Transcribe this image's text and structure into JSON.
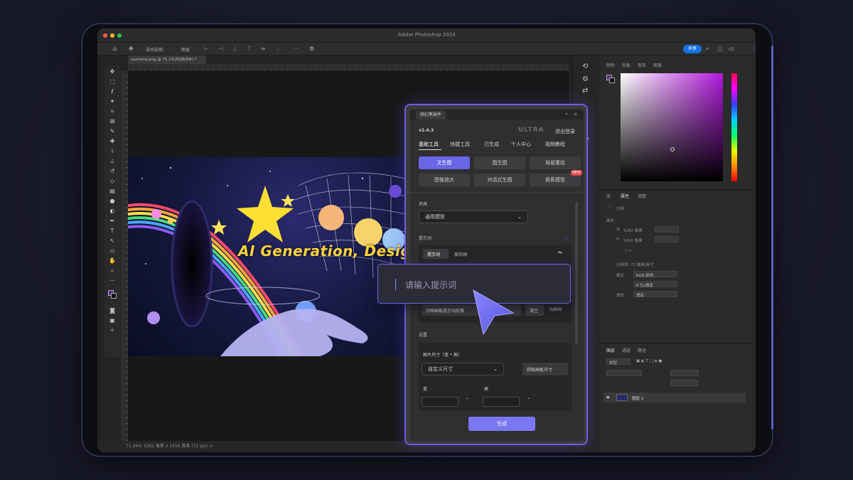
{
  "window": {
    "app_title": "Adobe Photoshop 2024",
    "share_label": "共享",
    "doc_tab": "sucheng.png @ 71.1%(RGB/8#) *",
    "status_text": "71.34%   3282 像素 x 1456 像素 (72 ppi)  >"
  },
  "options_bar": {
    "auto_select": "自动选择:",
    "layer_label": "图层"
  },
  "artwork": {
    "headline": "AI Generation, Design"
  },
  "plugin": {
    "header_tab": "颜幻笔插件",
    "version": "v2.4.3",
    "edition": "ULTRA",
    "logout": "退出登录",
    "nav": [
      "基础工具",
      "快捷工具",
      "已生成",
      "个人中心",
      "视频教程"
    ],
    "modes": [
      {
        "label": "文生图",
        "active": true
      },
      {
        "label": "图生图",
        "active": false
      },
      {
        "label": "局部重绘",
        "active": false
      },
      {
        "label": "图像放大",
        "active": false
      },
      {
        "label": "对话式生图",
        "active": false
      },
      {
        "label": "香蕉模型",
        "active": false,
        "badge": "NEW"
      }
    ],
    "style_label": "风格",
    "style_value": "通用模型",
    "prompt_label": "提示词",
    "prompt_tabs": [
      "提示词",
      "反向词"
    ],
    "prompt_helper": "识图画板提示词反推",
    "clear_label": "清空",
    "char_count": "0/800",
    "settings_label": "设置",
    "size_label": "图片尺寸（宽 * 高）",
    "size_value": "自定义尺寸",
    "get_canvas_size": "获取画板尺寸",
    "width_label": "宽",
    "height_label": "高",
    "generate_label": "生成"
  },
  "prompt_input": {
    "placeholder": "请输入提示词"
  },
  "right_panels": {
    "color_tabs": [
      "颜色",
      "色板",
      "渐变",
      "图案"
    ],
    "props_tabs": [
      "库",
      "属性",
      "调整"
    ],
    "doc_label": "文档",
    "canvas_label": "画布",
    "w_label": "W",
    "w_value": "3282 像素",
    "h_label": "H",
    "h_value": "1456 像素",
    "resolution": "分辨率: 72 像素/英寸",
    "mode_label": "模式",
    "mode_value": "RGB 颜色",
    "bit_value": "8 位/通道",
    "fill_label": "填充",
    "fill_value": "透底",
    "layers_tabs": [
      "图层",
      "通道",
      "路径"
    ],
    "layer_filter": "类型",
    "layer_name": "图层 1"
  },
  "colors": {
    "accent": "#6a66e8",
    "plugin_border": "#6b5fe0",
    "share": "#1473e6",
    "headline": "#ffd33d"
  }
}
